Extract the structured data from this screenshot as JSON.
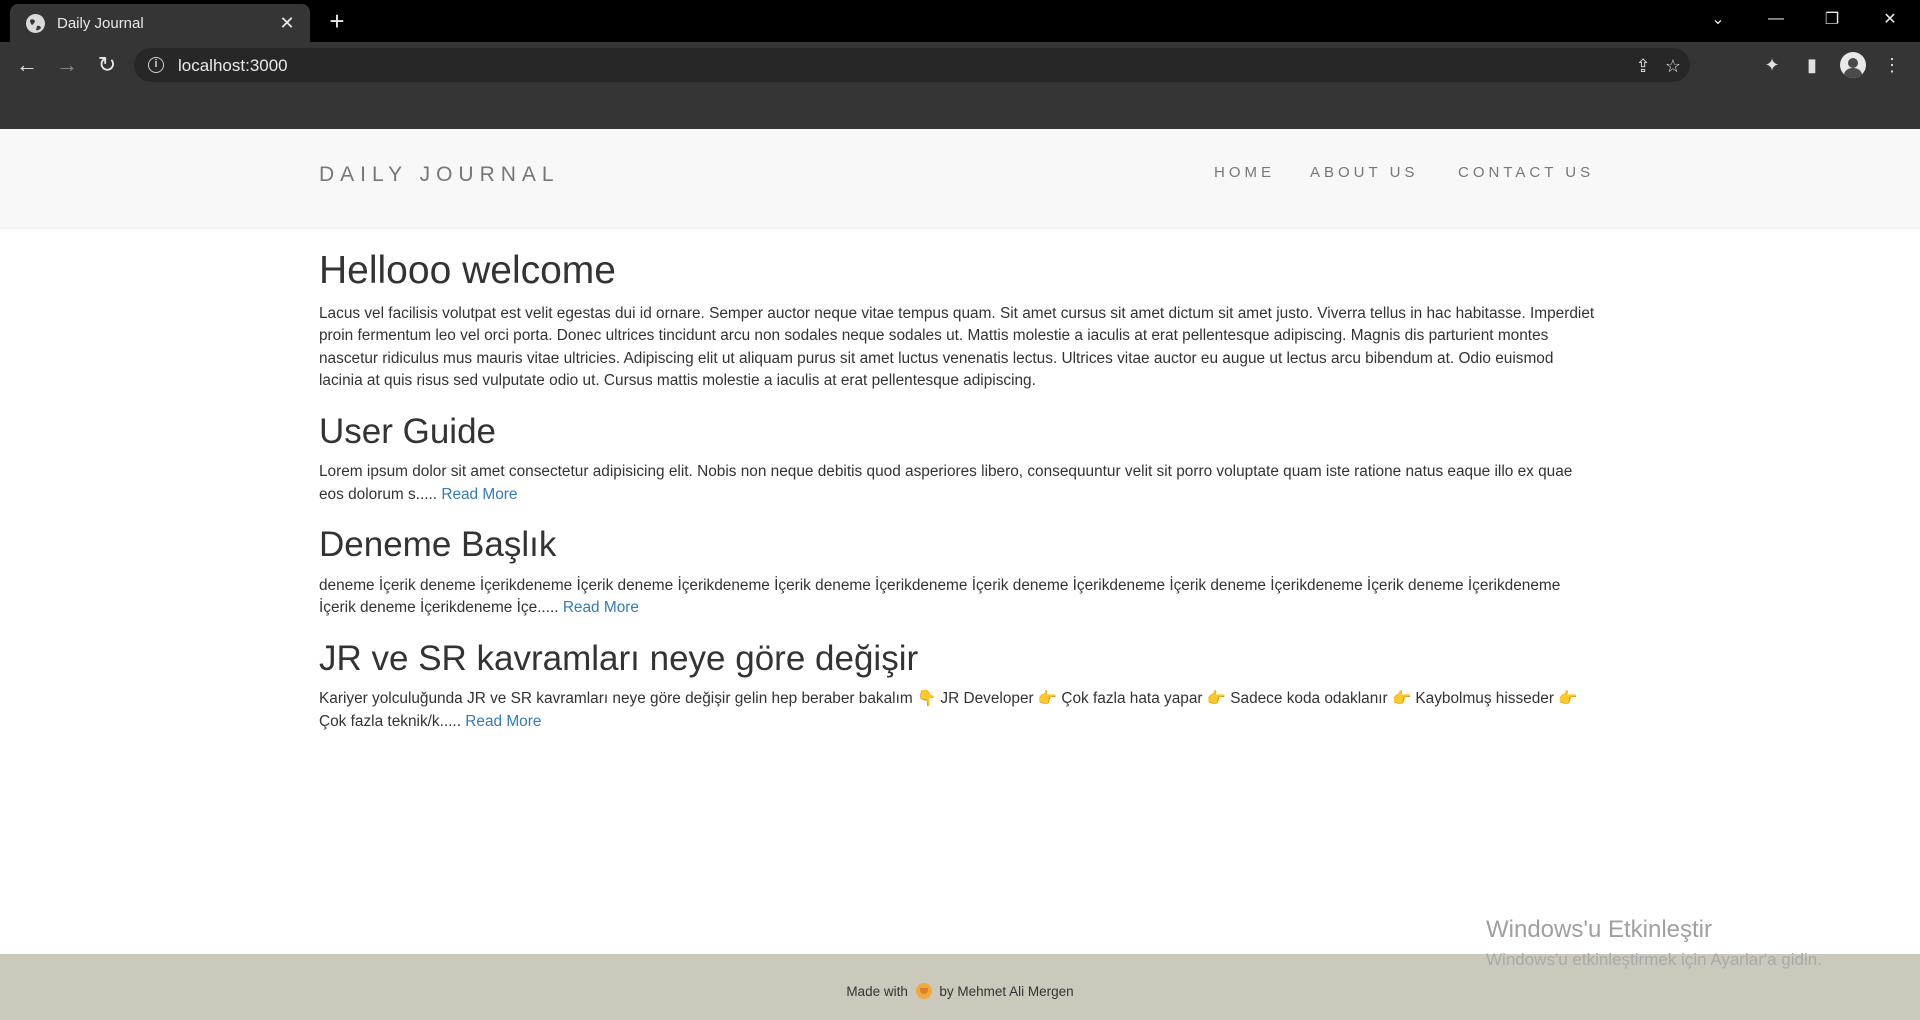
{
  "browser": {
    "tab_title": "Daily Journal",
    "tab_close": "✕",
    "new_tab": "+",
    "url": "localhost:3000",
    "window_controls": {
      "tab_search": "⌄",
      "minimize": "—",
      "restore": "❐",
      "close": "✕"
    }
  },
  "site": {
    "brand": "DAILY JOURNAL",
    "nav": [
      {
        "label": "HOME"
      },
      {
        "label": "ABOUT US"
      },
      {
        "label": "CONTACT US"
      }
    ]
  },
  "posts": [
    {
      "title": "Hellooo welcome",
      "body": "Lacus vel facilisis volutpat est velit egestas dui id ornare. Semper auctor neque vitae tempus quam. Sit amet cursus sit amet dictum sit amet justo. Viverra tellus in hac habitasse. Imperdiet proin fermentum leo vel orci porta. Donec ultrices tincidunt arcu non sodales neque sodales ut. Mattis molestie a iaculis at erat pellentesque adipiscing. Magnis dis parturient montes nascetur ridiculus mus mauris vitae ultricies. Adipiscing elit ut aliquam purus sit amet luctus venenatis lectus. Ultrices vitae auctor eu augue ut lectus arcu bibendum at. Odio euismod lacinia at quis risus sed vulputate odio ut. Cursus mattis molestie a iaculis at erat pellentesque adipiscing."
    },
    {
      "title": "User Guide",
      "body": "Lorem ipsum dolor sit amet consectetur adipisicing elit. Nobis non neque debitis quod asperiores libero, consequuntur velit sit porro voluptate quam iste ratione natus eaque illo ex quae eos dolorum s.....",
      "link": "Read More"
    },
    {
      "title": "Deneme Başlık",
      "body": "deneme İçerik deneme İçerikdeneme İçerik deneme İçerikdeneme İçerik deneme İçerikdeneme İçerik deneme İçerikdeneme İçerik deneme İçerikdeneme İçerik deneme İçerikdeneme İçerik deneme İçerikdeneme İçe.....",
      "link": "Read More"
    },
    {
      "title": "JR ve SR kavramları neye göre değişir",
      "body": "Kariyer yolculuğunda JR ve SR kavramları neye göre değişir gelin hep beraber bakalım 👇 JR Developer 👉 Çok fazla hata yapar 👉 Sadece koda odaklanır 👉 Kaybolmuş hisseder 👉 Çok fazla teknik/k.....",
      "link": "Read More"
    }
  ],
  "footer": {
    "prefix": "Made with",
    "suffix": "by Mehmet Ali Mergen"
  },
  "watermark": {
    "title": "Windows'u Etkinleştir",
    "subtitle": "Windows'u etkinleştirmek için Ayarlar'a gidin."
  },
  "colors": {
    "brand_text": "#777777",
    "link": "#337ab7",
    "footer_bg": "#cbc9bb",
    "header_bg": "#f8f8f8"
  }
}
